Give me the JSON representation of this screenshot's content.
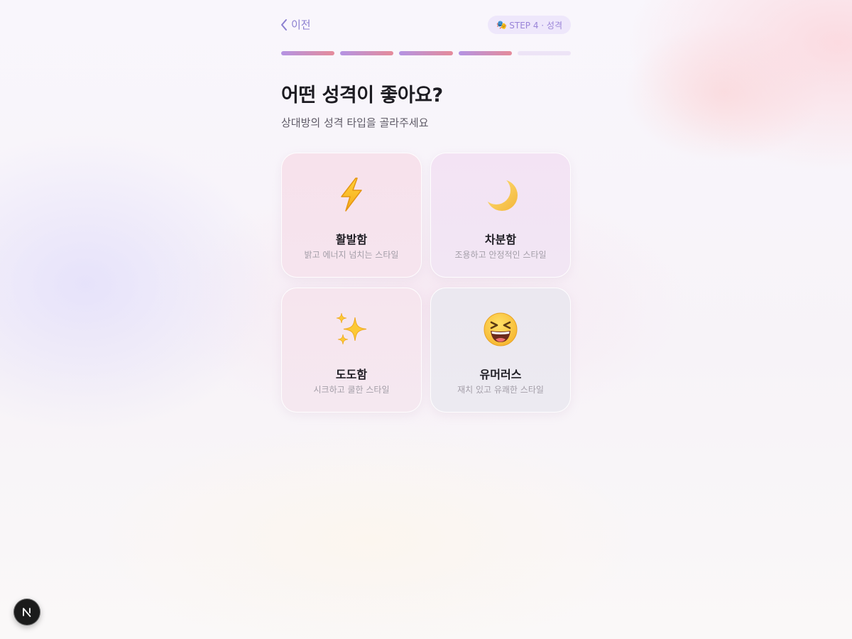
{
  "header": {
    "back_label": "이전",
    "step_emoji": "🎭",
    "step_label": "STEP 4 · 성격"
  },
  "progress": {
    "total_steps": 5,
    "completed_steps": 4
  },
  "main": {
    "title": "어떤 성격이 좋아요?",
    "subtitle": "상대방의 성격 타입을 골라주세요"
  },
  "options": [
    {
      "icon": "lightning-icon",
      "label": "활발함",
      "description": "밝고 에너지 넘치는 스타일"
    },
    {
      "icon": "crescent-moon-icon",
      "label": "차분함",
      "description": "조용하고 안정적인 스타일"
    },
    {
      "icon": "sparkles-icon",
      "label": "도도함",
      "description": "시크하고 쿨한 스타일"
    },
    {
      "icon": "laughing-face-icon",
      "label": "유머러스",
      "description": "재치 있고 유쾌한 스타일"
    }
  ],
  "colors": {
    "accent": "#8b7fd0",
    "progress_start": "#b493e3",
    "progress_end": "#e58b9a",
    "progress_empty": "#ede4f6"
  }
}
